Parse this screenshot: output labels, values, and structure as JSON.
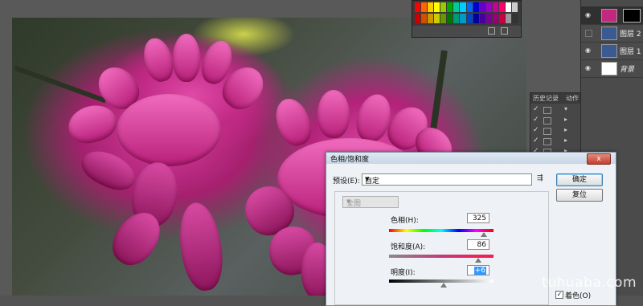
{
  "swatches": {
    "colors": [
      "#ff0000",
      "#ff6600",
      "#ffcc00",
      "#ffff00",
      "#99cc00",
      "#00aa00",
      "#00cc99",
      "#00ccff",
      "#0066ff",
      "#0000cc",
      "#6600cc",
      "#9900cc",
      "#cc0099",
      "#ff0066",
      "#ffffff",
      "#cccccc",
      "#cc0000",
      "#cc5200",
      "#cc9900",
      "#cccc00",
      "#669900",
      "#007700",
      "#009977",
      "#0099cc",
      "#0044cc",
      "#000099",
      "#440099",
      "#770099",
      "#990077",
      "#cc0044",
      "#999999",
      "#333333"
    ]
  },
  "layers": [
    {
      "name": "",
      "selected": true,
      "thumb": "#c2287f"
    },
    {
      "name": "图层 2",
      "selected": false,
      "thumb": "#3b5a8f"
    },
    {
      "name": "图层 1",
      "selected": false,
      "thumb": "#3b5a8f"
    },
    {
      "name": "背景",
      "selected": false,
      "thumb": "#ffffff"
    }
  ],
  "history": {
    "tab1": "历史记录",
    "tab2": "动作",
    "rows": [
      "",
      "",
      "",
      "",
      ""
    ]
  },
  "dialog": {
    "title": "色相/饱和度",
    "close": "x",
    "preset_label": "预设(E):",
    "preset_value": "自定",
    "ok": "确定",
    "reset": "复位",
    "channel": "全图",
    "hue_label": "色相(H):",
    "hue_value": "325",
    "sat_label": "饱和度(A):",
    "sat_value": "86",
    "light_label": "明度(I):",
    "light_value": "+6",
    "colorize_label": "着色(O)"
  },
  "watermark": "tuhuaba.com"
}
